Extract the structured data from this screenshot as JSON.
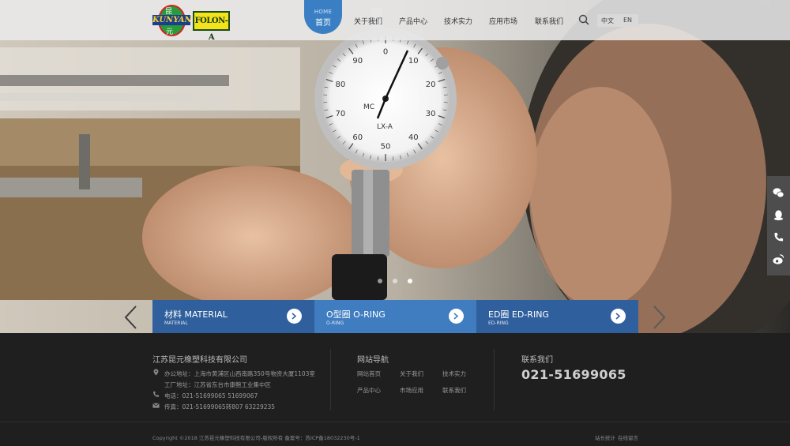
{
  "brand": {
    "logo1_top": "昆",
    "logo1_text": "KUNYAN",
    "logo1_bottom": "元",
    "logo2_text": "FOLON-A"
  },
  "nav": {
    "home_en": "HOME",
    "home_cn": "首页",
    "items": [
      "关于我们",
      "产品中心",
      "技术实力",
      "应用市场",
      "联系我们"
    ],
    "lang_cn": "中文",
    "lang_en": "EN"
  },
  "slider": {
    "dots": 3,
    "active_dot": 3,
    "categories": [
      {
        "title": "材料 MATERIAL",
        "subtitle": "MATERIAL"
      },
      {
        "title": "O型圈 O-RING",
        "subtitle": "O-RING"
      },
      {
        "title": "ED圈 ED-RING",
        "subtitle": "ED-RING"
      }
    ]
  },
  "gauge": {
    "brand": "MC",
    "model": "LX-A",
    "numbers": [
      "0",
      "10",
      "20",
      "30",
      "40",
      "50",
      "60",
      "70",
      "80",
      "90"
    ]
  },
  "footer": {
    "company": "江苏昆元橡塑科技有限公司",
    "office": "办公地址：上海市黄浦区山西南路350号物资大厦1103室",
    "factory": "工厂地址：江苏省东台市康鲍工业集中区",
    "tel": "电话：021-51699065 51699067",
    "fax": "传真：021-51699065转807 63229235",
    "nav_title": "网站导航",
    "nav_links": [
      "网站首页",
      "关于我们",
      "技术实力",
      "产品中心",
      "市场应用",
      "联系我们"
    ],
    "contact_title": "联系我们",
    "phone": "021-51699065",
    "copyright": "Copyright ©2018 江苏昆元橡塑科技有限公司-版权所有  备案号：苏ICP备18032230号-1",
    "stats": "站长统计",
    "message": "在线留言"
  },
  "side_icons": [
    "wechat-icon",
    "qq-icon",
    "phone-icon",
    "weibo-icon"
  ],
  "colors": {
    "accent": "#3a7fc4",
    "cat1": "#2f5f9c",
    "cat2": "#3f7cc0",
    "cat3": "#2f5f9c",
    "footer_bg": "#1f1f1f"
  }
}
